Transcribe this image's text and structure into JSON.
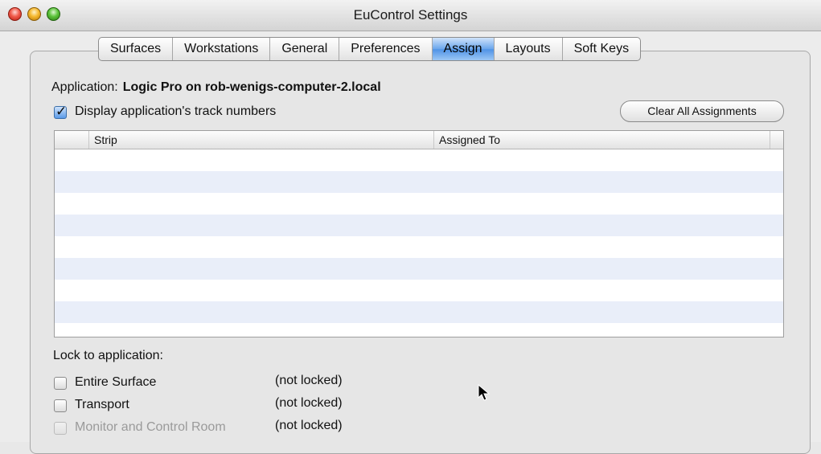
{
  "window": {
    "title": "EuControl Settings"
  },
  "tabs": [
    {
      "label": "Surfaces",
      "active": false
    },
    {
      "label": "Workstations",
      "active": false
    },
    {
      "label": "General",
      "active": false
    },
    {
      "label": "Preferences",
      "active": false
    },
    {
      "label": "Assign",
      "active": true
    },
    {
      "label": "Layouts",
      "active": false
    },
    {
      "label": "Soft Keys",
      "active": false
    }
  ],
  "application": {
    "label": "Application:",
    "value": "Logic Pro on rob-wenigs-computer-2.local"
  },
  "display_track_numbers": {
    "label": "Display application's track numbers",
    "checked": true
  },
  "clear_button": {
    "label": "Clear All Assignments"
  },
  "table": {
    "columns": [
      "Strip",
      "Assigned To"
    ],
    "rows": []
  },
  "lock": {
    "title": "Lock to application:",
    "items": [
      {
        "label": "Entire Surface",
        "status": "(not locked)",
        "checked": false,
        "enabled": true
      },
      {
        "label": "Transport",
        "status": "(not locked)",
        "checked": false,
        "enabled": true
      },
      {
        "label": "Monitor and Control Room",
        "status": "(not locked)",
        "checked": false,
        "enabled": false
      }
    ]
  },
  "colors": {
    "accent": "#5a9ae8",
    "row_stripe": "#e9eef9"
  }
}
